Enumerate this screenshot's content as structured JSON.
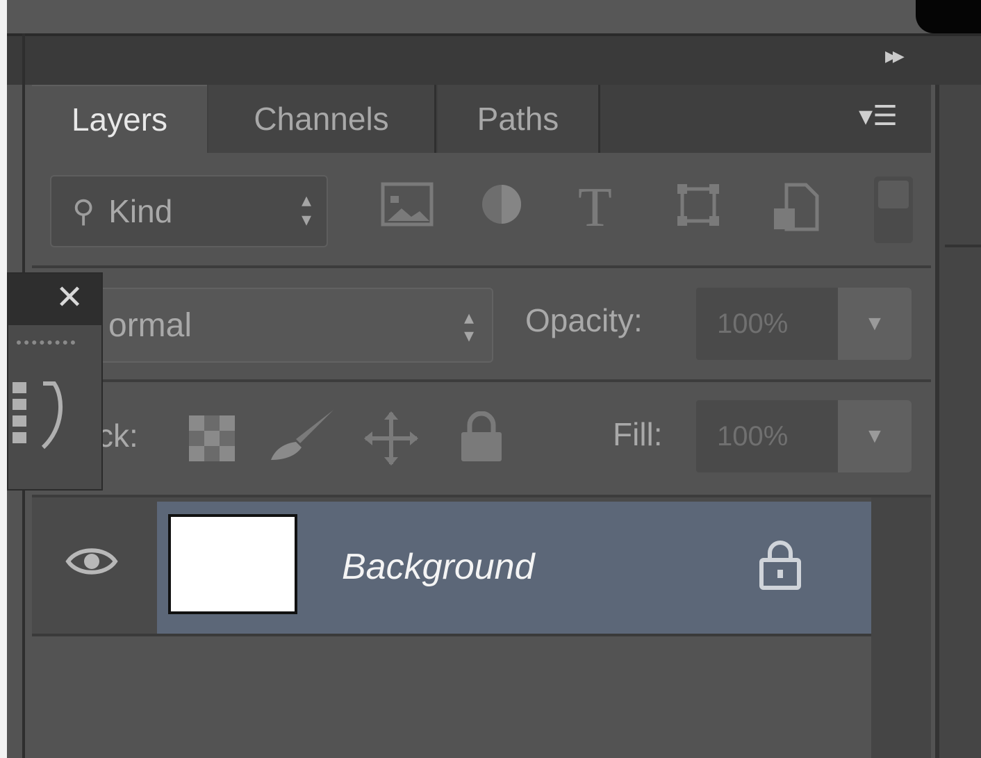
{
  "panel": {
    "tabs": [
      {
        "label": "Layers",
        "active": true
      },
      {
        "label": "Channels",
        "active": false
      },
      {
        "label": "Paths",
        "active": false
      }
    ],
    "collapse_icon": "double-chevron-right-icon",
    "menu_icon": "panel-menu-icon"
  },
  "filter": {
    "kind_label": "Kind",
    "icons": [
      "pixel-layer-filter-icon",
      "adjustment-layer-filter-icon",
      "type-layer-filter-icon",
      "shape-layer-filter-icon",
      "smart-object-filter-icon"
    ],
    "type_glyph": "T"
  },
  "blend": {
    "mode_label": "ormal",
    "opacity_label": "Opacity:",
    "opacity_value": "100%"
  },
  "lock": {
    "label": "ck:",
    "fill_label": "Fill:",
    "fill_value": "100%",
    "icons": [
      "lock-transparent-pixels-icon",
      "lock-image-pixels-icon",
      "lock-position-icon",
      "lock-all-icon"
    ]
  },
  "layers": [
    {
      "name": "Background",
      "visible": true,
      "locked": true,
      "selected": true,
      "thumbnail_color": "#ffffff"
    }
  ],
  "colors": {
    "panel_bg": "#535353",
    "selected_row": "#5c6778",
    "text_active": "#e8e8e8",
    "text_muted": "#a9a9a9"
  }
}
